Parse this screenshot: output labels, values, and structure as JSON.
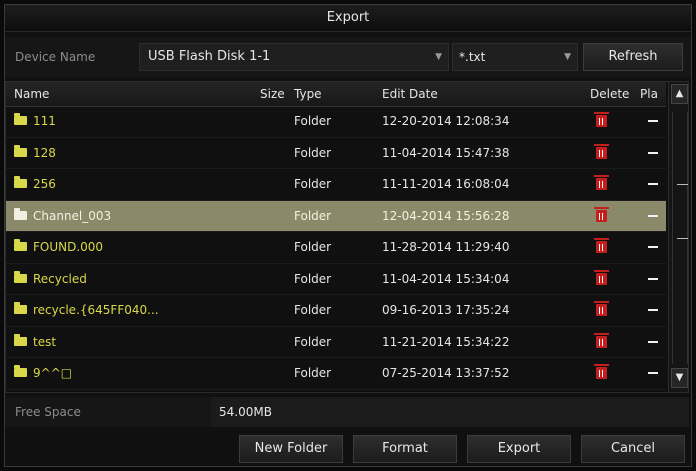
{
  "dialog": {
    "title": "Export"
  },
  "device": {
    "label": "Device Name",
    "selected": "USB Flash Disk 1-1",
    "filter": "*.txt",
    "refresh_label": "Refresh"
  },
  "table": {
    "headers": {
      "name": "Name",
      "size": "Size",
      "type": "Type",
      "edit_date": "Edit Date",
      "delete": "Delete",
      "play": "Pla"
    },
    "rows": [
      {
        "name": "111",
        "type": "Folder",
        "date": "12-20-2014 12:08:34"
      },
      {
        "name": "128",
        "type": "Folder",
        "date": "11-04-2014 15:47:38"
      },
      {
        "name": "256",
        "type": "Folder",
        "date": "11-11-2014 16:08:04"
      },
      {
        "name": "Channel_003",
        "type": "Folder",
        "date": "12-04-2014 15:56:28"
      },
      {
        "name": "FOUND.000",
        "type": "Folder",
        "date": "11-28-2014 11:29:40"
      },
      {
        "name": "Recycled",
        "type": "Folder",
        "date": "11-04-2014 15:34:04"
      },
      {
        "name": "recycle.{645FF040...",
        "type": "Folder",
        "date": "09-16-2013 17:35:24"
      },
      {
        "name": "test",
        "type": "Folder",
        "date": "11-21-2014 15:34:22"
      },
      {
        "name": "9^^□",
        "type": "Folder",
        "date": "07-25-2014 13:37:52"
      }
    ],
    "selected_row": "Channel_003"
  },
  "free_space": {
    "label": "Free Space",
    "value": "54.00MB"
  },
  "buttons": {
    "new_folder": "New Folder",
    "format": "Format",
    "export": "Export",
    "cancel": "Cancel"
  },
  "icons": {
    "folder": "folder-icon",
    "delete": "trash-icon",
    "play": "dash-icon",
    "scroll_up": "chevron-up-icon",
    "scroll_down": "chevron-down-icon"
  },
  "colors": {
    "folder_name": "#d8d84a",
    "selected_row": "#8a8a6a",
    "delete_icon": "#c41e1e"
  }
}
